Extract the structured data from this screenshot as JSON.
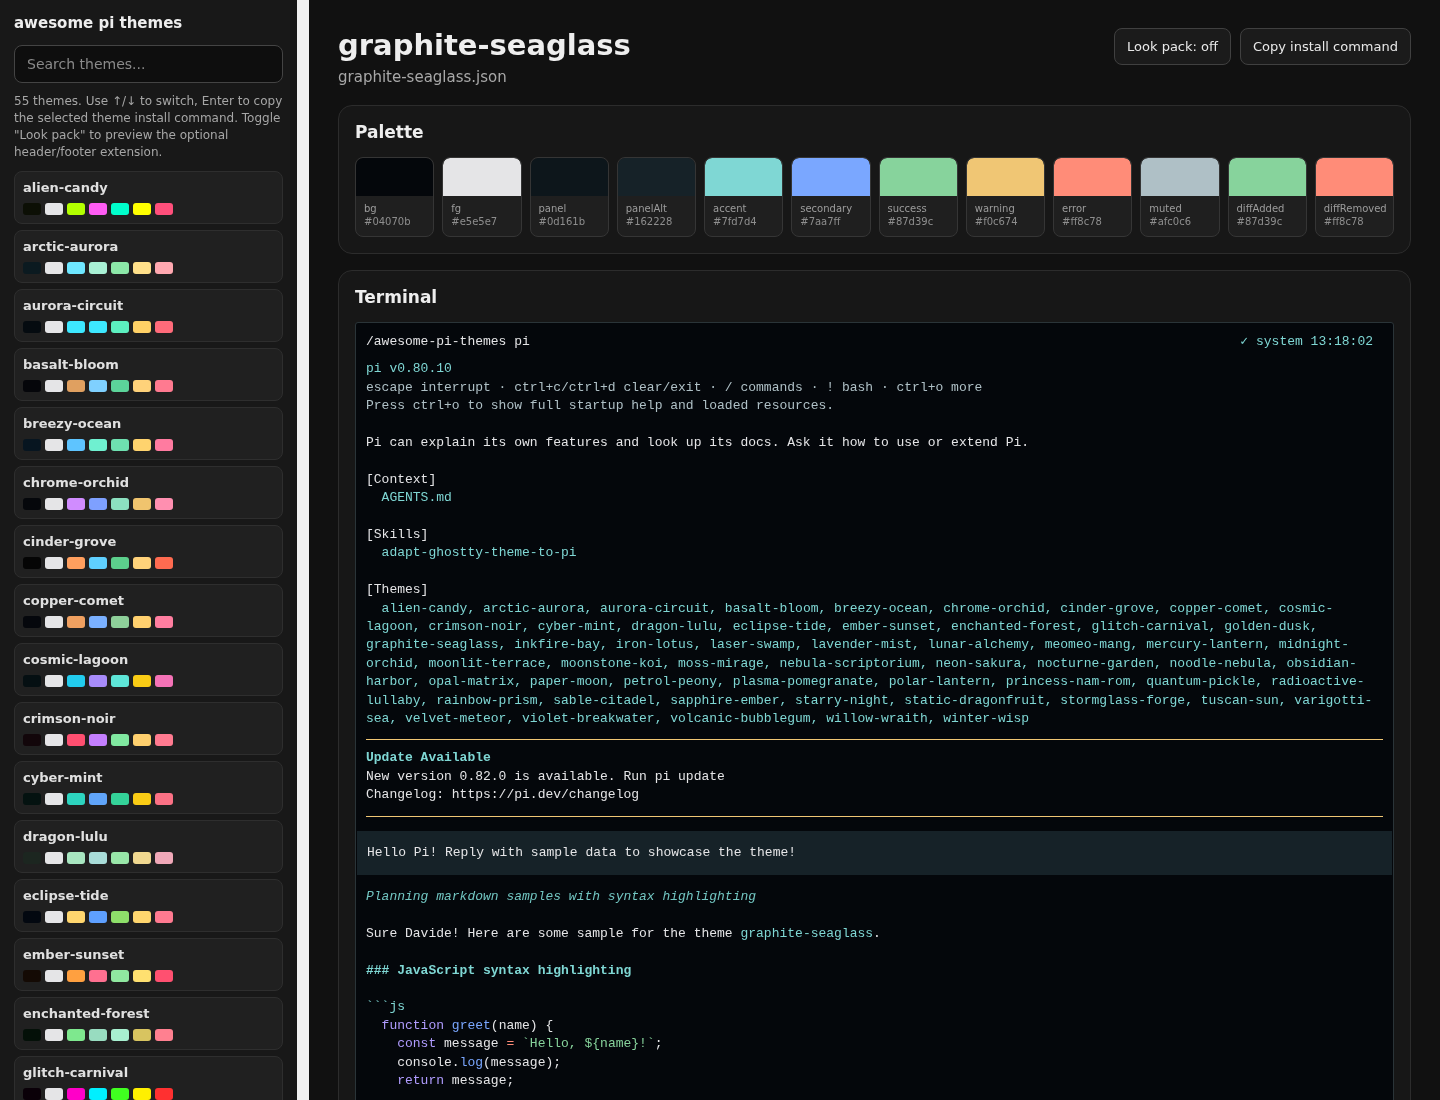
{
  "sidebar": {
    "title": "awesome pi themes",
    "search": {
      "placeholder": "Search themes..."
    },
    "help": "55 themes. Use ↑/↓ to switch, Enter to copy the selected theme install command. Toggle \"Look pack\" to preview the optional header/footer extension.",
    "themes": [
      {
        "name": "alien-candy",
        "selected": false,
        "swatches": [
          {
            "color": "#0c0f05"
          },
          {
            "color": "#e5e5e7"
          },
          {
            "color": "#b3ff00"
          },
          {
            "color": "#ff5cf4"
          },
          {
            "color": "#00ffcc"
          },
          {
            "color": "#ffff00"
          },
          {
            "color": "#ff4f7b"
          }
        ]
      },
      {
        "name": "arctic-aurora",
        "selected": false,
        "swatches": [
          {
            "color": "#0b1a20"
          },
          {
            "color": "#e5e5e7"
          },
          {
            "color": "#6ee7ff"
          },
          {
            "color": "#a8f0d4"
          },
          {
            "color": "#8ce8a8"
          },
          {
            "color": "#ffe08a"
          },
          {
            "color": "#ffa8b0"
          }
        ]
      },
      {
        "name": "aurora-circuit",
        "selected": false,
        "swatches": [
          {
            "color": "#050b10"
          },
          {
            "color": "#e5e5e7"
          },
          {
            "color": "#3de8ff"
          },
          {
            "color": "#3de8ff"
          },
          {
            "color": "#5cf0c0"
          },
          {
            "color": "#ffd166"
          },
          {
            "color": "#ff6b7a"
          }
        ]
      },
      {
        "name": "basalt-bloom",
        "selected": false,
        "swatches": [
          {
            "color": "#05060a"
          },
          {
            "color": "#e5e5e7"
          },
          {
            "color": "#e0a060"
          },
          {
            "color": "#7fd0ff"
          },
          {
            "color": "#5cd49a"
          },
          {
            "color": "#ffd27a"
          },
          {
            "color": "#ff7a90"
          }
        ]
      },
      {
        "name": "breezy-ocean",
        "selected": false,
        "swatches": [
          {
            "color": "#071520"
          },
          {
            "color": "#e5e5e7"
          },
          {
            "color": "#5ec4ff"
          },
          {
            "color": "#6ff0d0"
          },
          {
            "color": "#6ee0b0"
          },
          {
            "color": "#ffd36e"
          },
          {
            "color": "#ff7ba0"
          }
        ]
      },
      {
        "name": "chrome-orchid",
        "selected": false,
        "swatches": [
          {
            "color": "#05070b"
          },
          {
            "color": "#e5e5e7"
          },
          {
            "color": "#d08cff"
          },
          {
            "color": "#7ea0ff"
          },
          {
            "color": "#8ce0c0"
          },
          {
            "color": "#f0c46e"
          },
          {
            "color": "#ff8fb0"
          }
        ]
      },
      {
        "name": "cinder-grove",
        "selected": false,
        "swatches": [
          {
            "color": "#050505"
          },
          {
            "color": "#e5e5e7"
          },
          {
            "color": "#ff9f5e"
          },
          {
            "color": "#5fd0ff"
          },
          {
            "color": "#5cd08c"
          },
          {
            "color": "#ffd27a"
          },
          {
            "color": "#ff6b50"
          }
        ]
      },
      {
        "name": "copper-comet",
        "selected": false,
        "swatches": [
          {
            "color": "#05070c"
          },
          {
            "color": "#e5e5e7"
          },
          {
            "color": "#f0a060"
          },
          {
            "color": "#7ab0ff"
          },
          {
            "color": "#8ed09a"
          },
          {
            "color": "#ffd06e"
          },
          {
            "color": "#ff7ea0"
          }
        ]
      },
      {
        "name": "cosmic-lagoon",
        "selected": false,
        "swatches": [
          {
            "color": "#050f12"
          },
          {
            "color": "#e5e5e7"
          },
          {
            "color": "#22ccee"
          },
          {
            "color": "#a78bfa"
          },
          {
            "color": "#5ee6d8"
          },
          {
            "color": "#facc15"
          },
          {
            "color": "#f472b6"
          }
        ]
      },
      {
        "name": "crimson-noir",
        "selected": false,
        "swatches": [
          {
            "color": "#12060a"
          },
          {
            "color": "#e5e5e7"
          },
          {
            "color": "#ff4f70"
          },
          {
            "color": "#c47fff"
          },
          {
            "color": "#80e8a0"
          },
          {
            "color": "#ffd06e"
          },
          {
            "color": "#ff7a90"
          }
        ]
      },
      {
        "name": "cyber-mint",
        "selected": false,
        "swatches": [
          {
            "color": "#041210"
          },
          {
            "color": "#e5e5e7"
          },
          {
            "color": "#2dd4bf"
          },
          {
            "color": "#60a5fa"
          },
          {
            "color": "#34d399"
          },
          {
            "color": "#facc15"
          },
          {
            "color": "#fb7185"
          }
        ]
      },
      {
        "name": "dragon-lulu",
        "selected": false,
        "swatches": [
          {
            "color": "#1c2620"
          },
          {
            "color": "#e5e5e7"
          },
          {
            "color": "#a8e6c0"
          },
          {
            "color": "#a8dcd8"
          },
          {
            "color": "#98e6a8"
          },
          {
            "color": "#f0d890"
          },
          {
            "color": "#f0a8b8"
          }
        ]
      },
      {
        "name": "eclipse-tide",
        "selected": false,
        "swatches": [
          {
            "color": "#030810"
          },
          {
            "color": "#e5e5e7"
          },
          {
            "color": "#ffd66e"
          },
          {
            "color": "#5ea0ff"
          },
          {
            "color": "#8ee06a"
          },
          {
            "color": "#ffd66e"
          },
          {
            "color": "#ff7a90"
          }
        ]
      },
      {
        "name": "ember-sunset",
        "selected": false,
        "swatches": [
          {
            "color": "#140a04"
          },
          {
            "color": "#e5e5e7"
          },
          {
            "color": "#ffa040"
          },
          {
            "color": "#ff7090"
          },
          {
            "color": "#90e8a0"
          },
          {
            "color": "#ffe070"
          },
          {
            "color": "#ff5070"
          }
        ]
      },
      {
        "name": "enchanted-forest",
        "selected": false,
        "swatches": [
          {
            "color": "#041008"
          },
          {
            "color": "#e5e5e7"
          },
          {
            "color": "#7ee88e"
          },
          {
            "color": "#98dcc0"
          },
          {
            "color": "#a8f0d0"
          },
          {
            "color": "#d8c460"
          },
          {
            "color": "#ff8090"
          }
        ]
      },
      {
        "name": "glitch-carnival",
        "selected": false,
        "swatches": [
          {
            "color": "#0a0008"
          },
          {
            "color": "#e5e5e7"
          },
          {
            "color": "#ff00c8"
          },
          {
            "color": "#00f0ff"
          },
          {
            "color": "#40ff20"
          },
          {
            "color": "#fff000"
          },
          {
            "color": "#ff3030"
          }
        ]
      }
    ]
  },
  "header": {
    "title": "graphite-seaglass",
    "file": "graphite-seaglass.json",
    "look_pack_button": "Look pack: off",
    "copy_button": "Copy install command"
  },
  "palette": {
    "title": "Palette",
    "colors": [
      {
        "name": "bg",
        "hex": "#04070b",
        "color": "#04070b"
      },
      {
        "name": "fg",
        "hex": "#e5e5e7",
        "color": "#e5e5e7"
      },
      {
        "name": "panel",
        "hex": "#0d161b",
        "color": "#0d161b"
      },
      {
        "name": "panelAlt",
        "hex": "#162228",
        "color": "#162228"
      },
      {
        "name": "accent",
        "hex": "#7fd7d4",
        "color": "#7fd7d4"
      },
      {
        "name": "secondary",
        "hex": "#7aa7ff",
        "color": "#7aa7ff"
      },
      {
        "name": "success",
        "hex": "#87d39c",
        "color": "#87d39c"
      },
      {
        "name": "warning",
        "hex": "#f0c674",
        "color": "#f0c674"
      },
      {
        "name": "error",
        "hex": "#ff8c78",
        "color": "#ff8c78"
      },
      {
        "name": "muted",
        "hex": "#afc0c6",
        "color": "#afc0c6"
      },
      {
        "name": "diffAdded",
        "hex": "#87d39c",
        "color": "#87d39c"
      },
      {
        "name": "diffRemoved",
        "hex": "#ff8c78",
        "color": "#ff8c78"
      }
    ]
  },
  "terminal": {
    "title": "Terminal",
    "path": "/awesome-pi-themes pi",
    "status": "✓ system 13:18:02",
    "intro": [
      {
        "lines": [
          {
            "kind": "accent",
            "text": "pi v0.80.10"
          },
          {
            "kind": "muted",
            "text": "escape interrupt · ctrl+c/ctrl+d clear/exit · / commands · ! bash · ctrl+o more"
          },
          {
            "kind": "muted",
            "text": "Press ctrl+o to show full startup help and loaded resources."
          }
        ]
      },
      {
        "lines": [
          {
            "kind": "plain",
            "text": "Pi can explain its own features and look up its docs. Ask it how to use or extend Pi."
          }
        ]
      },
      {
        "lines": [
          {
            "kind": "plain",
            "text": "[Context]"
          },
          {
            "kind": "accent",
            "text": "  AGENTS.md"
          }
        ]
      },
      {
        "lines": [
          {
            "kind": "plain",
            "text": "[Skills]"
          },
          {
            "kind": "accent",
            "text": "  adapt-ghostty-theme-to-pi"
          }
        ]
      },
      {
        "lines": [
          {
            "kind": "plain",
            "text": "[Themes]"
          },
          {
            "kind": "accent",
            "text": "  alien-candy, arctic-aurora, aurora-circuit, basalt-bloom, breezy-ocean, chrome-orchid, cinder-grove, copper-comet, cosmic-lagoon, crimson-noir, cyber-mint, dragon-lulu, eclipse-tide, ember-sunset, enchanted-forest, glitch-carnival, golden-dusk, graphite-seaglass, inkfire-bay, iron-lotus, laser-swamp, lavender-mist, lunar-alchemy, meomeo-mang, mercury-lantern, midnight-orchid, moonlit-terrace, moonstone-koi, moss-mirage, nebula-scriptorium, neon-sakura, nocturne-garden, noodle-nebula, obsidian-harbor, opal-matrix, paper-moon, petrol-peony, plasma-pomegranate, polar-lantern, princess-nam-rom, quantum-pickle, radioactive-lullaby, rainbow-prism, sable-citadel, sapphire-ember, starry-night, static-dragonfruit, stormglass-forge, tuscan-sun, varigotti-sea, velvet-meteor, violet-breakwater, volcanic-bubblegum, willow-wraith, winter-wisp"
          }
        ]
      }
    ],
    "notice": {
      "title": "Update Available",
      "lines": [
        "New version 0.82.0 is available. Run pi update",
        "Changelog: https://pi.dev/changelog"
      ]
    },
    "prompt": "Hello Pi! Reply with sample data to showcase the theme!",
    "response": [
      {
        "lines": [
          {
            "kind": "thinking",
            "text": "Planning markdown samples with syntax highlighting"
          }
        ]
      },
      {
        "lines": [
          {
            "kind": "plain",
            "tokens": [
              {
                "kind": "plain",
                "text": "Sure Davide! Here are some sample for the theme "
              },
              {
                "kind": "accent",
                "text": "graphite-seaglass"
              },
              {
                "kind": "plain",
                "text": "."
              }
            ]
          }
        ]
      },
      {
        "lines": [
          {
            "kind": "heading",
            "text": "### JavaScript syntax highlighting"
          }
        ]
      },
      {
        "lines": [
          {
            "kind": "accent",
            "text": "```js"
          },
          {
            "kind": "plain",
            "tokens": [
              {
                "kind": "keyword",
                "text": "  function"
              },
              {
                "kind": "function",
                "text": " greet"
              },
              {
                "kind": "plain",
                "text": "(name) {"
              }
            ]
          },
          {
            "kind": "plain",
            "tokens": [
              {
                "kind": "keyword",
                "text": "    const"
              },
              {
                "kind": "plain",
                "text": " message "
              },
              {
                "kind": "operator",
                "text": "="
              },
              {
                "kind": "string",
                "text": " `Hello, ${name}!`"
              },
              {
                "kind": "plain",
                "text": ";"
              }
            ]
          },
          {
            "kind": "plain",
            "tokens": [
              {
                "kind": "plain",
                "text": "    console."
              },
              {
                "kind": "function",
                "text": "log"
              },
              {
                "kind": "plain",
                "text": "(message);"
              }
            ]
          },
          {
            "kind": "plain",
            "tokens": [
              {
                "kind": "keyword",
                "text": "    return"
              },
              {
                "kind": "plain",
                "text": " message;"
              }
            ]
          }
        ]
      }
    ]
  }
}
